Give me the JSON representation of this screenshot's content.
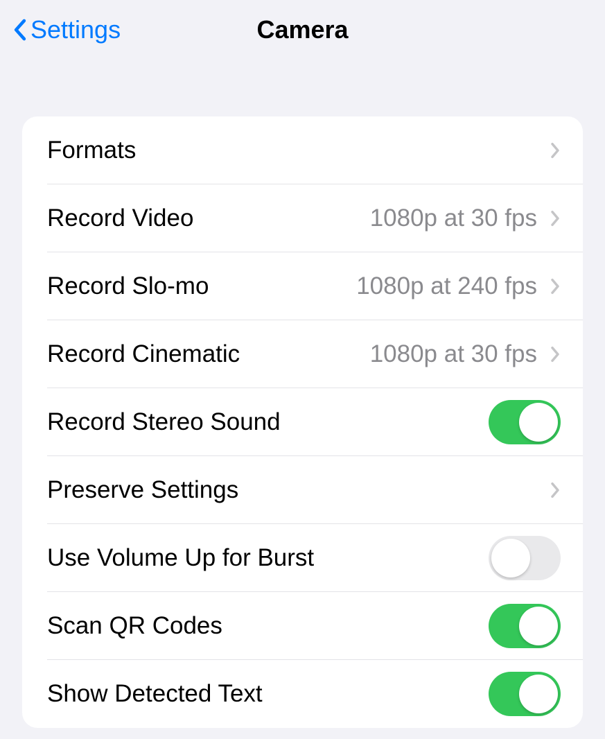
{
  "nav": {
    "back_label": "Settings",
    "title": "Camera"
  },
  "rows": {
    "formats": {
      "label": "Formats"
    },
    "record_video": {
      "label": "Record Video",
      "value": "1080p at 30 fps"
    },
    "record_slomo": {
      "label": "Record Slo-mo",
      "value": "1080p at 240 fps"
    },
    "record_cinematic": {
      "label": "Record Cinematic",
      "value": "1080p at 30 fps"
    },
    "record_stereo": {
      "label": "Record Stereo Sound",
      "toggle": true
    },
    "preserve": {
      "label": "Preserve Settings"
    },
    "volume_burst": {
      "label": "Use Volume Up for Burst",
      "toggle": false
    },
    "scan_qr": {
      "label": "Scan QR Codes",
      "toggle": true
    },
    "detected_text": {
      "label": "Show Detected Text",
      "toggle": true
    }
  }
}
